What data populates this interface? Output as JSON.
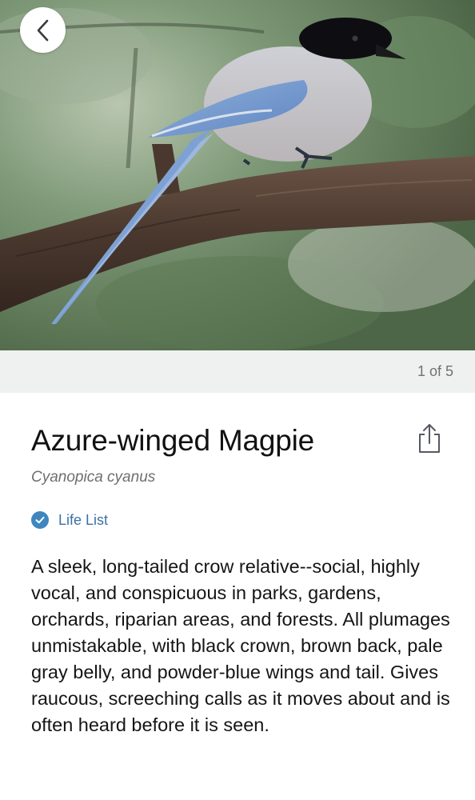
{
  "photo": {
    "icon": "bird-photo"
  },
  "nav": {
    "back_icon": "chevron-left-icon"
  },
  "gallery": {
    "counter": "1 of 5"
  },
  "species": {
    "common_name": "Azure-winged Magpie",
    "scientific_name": "Cyanopica cyanus",
    "share_icon": "share-icon"
  },
  "life_list": {
    "label": "Life List",
    "checked": true,
    "color": "#3f86c0"
  },
  "description": "A sleek, long-tailed crow relative--social, highly vocal, and conspicuous in parks, gardens, orchards, riparian areas, and forests. All plumages unmistakable, with black crown, brown back, pale gray belly, and powder-blue wings and tail. Gives raucous, screeching calls as it moves about and is often heard before it is seen."
}
